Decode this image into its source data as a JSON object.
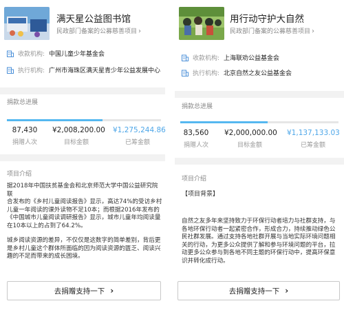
{
  "left": {
    "title": "满天星公益图书馆",
    "subtitle": "民政部门备案的公募慈善项目",
    "raise_org_label": "收款机构:",
    "raise_org": "中国儿童少年基金会",
    "exec_org_label": "执行机构:",
    "exec_org": "广州市海珠区满天星青少年公益发展中心",
    "progress_label": "捐款总进展",
    "progress_fraction": 0.62,
    "donors": "87,430",
    "donors_label": "捐赠人次",
    "target": "¥2,008,200.00",
    "target_label": "目标金额",
    "raised": "¥1,275,244.86",
    "raised_label": "已筹金额",
    "intro_label": "项目介绍",
    "intro_p1": [
      "据2018年中国扶贫基金会和北京师范大学中国公益研究院联",
      "合发布的《乡村儿童阅读报告》显示，高达74%的受访乡村",
      "儿童一年阅读的课外读物不足10本；而根据2016年发布的",
      "《中国城市儿童阅读调研报告》显示，城市儿童年均阅读量",
      "在10本以上的占到了64.2%。"
    ],
    "intro_p2": [
      "城乡阅读资源的差异，不仅仅是这数字的简单差别，背后更",
      "是乡村儿童这个群体所面临的因为阅读资源的匮乏、阅读兴",
      "趣的不足而带来的成长困境。"
    ],
    "donate_label": "去捐赠支持一下"
  },
  "right": {
    "title": "用行动守护大自然",
    "subtitle": "民政部门备案的公募慈善项目",
    "raise_org_label": "收款机构:",
    "raise_org": "上海联劝公益基金会",
    "exec_org_label": "执行机构:",
    "exec_org": "北京自然之友公益基金会",
    "progress_label": "捐款总进展",
    "progress_fraction": 0.55,
    "donors": "83,560",
    "donors_label": "捐赠人次",
    "target": "¥2,000,000.00",
    "target_label": "目标金额",
    "raised": "¥1,137,133.03",
    "raised_label": "已筹金额",
    "intro_label": "项目介绍",
    "background_label": "【项目背景】",
    "intro_p1": [
      "自然之友多年来坚持致力于环保行动者培力与社群支持，与",
      "各地环保行动者一起紧密合作，形成合力，持续推动绿色公",
      "民社群发展。通过支持各地社群开展与当地实际环境问题相",
      "关的行动，为更多公众提供了解和参与环境问题的平台，拉",
      "动更多公众参与到各地不同主题的环保行动中，提高环保意",
      "识并转化成行动。"
    ],
    "donate_label": "去捐赠支持一下"
  },
  "colors": {
    "accent": "#4da6e8",
    "progress": "#55b8f0",
    "gap": "#f2f2f2"
  },
  "icons": {
    "org": "building-icon",
    "arrow": "chevron-right-icon"
  }
}
